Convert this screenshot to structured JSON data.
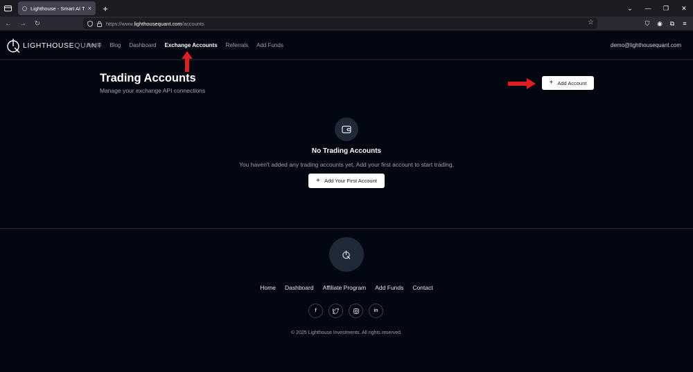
{
  "browser": {
    "tab_title": "Lighthouse - Smart AI Trading",
    "tab_close": "×",
    "new_tab": "+",
    "url_prefix": "https://www.",
    "url_host": "lighthousequant.com",
    "url_path": "/accounts",
    "back": "←",
    "forward": "→",
    "reload": "↻",
    "minimize": "—",
    "restore": "❐",
    "close": "✕"
  },
  "site": {
    "logo_bold": "LIGHTHOUSE",
    "logo_thin": "QUANT",
    "nav": [
      "Home",
      "Blog",
      "Dashboard",
      "Exchange Accounts",
      "Referrals",
      "Add Funds"
    ],
    "active_nav": "Exchange Accounts",
    "user_email": "demo@lighthousequant.com"
  },
  "main": {
    "title": "Trading Accounts",
    "subtitle": "Manage your exchange API connections",
    "add_account_label": "Add Account",
    "empty_title": "No Trading Accounts",
    "empty_text": "You haven't added any trading accounts yet. Add your first account to start trading.",
    "add_first_label": "Add Your First Account",
    "empty_icon": "wallet-icon"
  },
  "footer": {
    "links": [
      "Home",
      "Dashboard",
      "Affiliate Program",
      "Add Funds",
      "Contact"
    ],
    "socials": [
      {
        "icon": "facebook-icon",
        "glyph": "f"
      },
      {
        "icon": "twitter-icon",
        "glyph": "🐦"
      },
      {
        "icon": "instagram-icon",
        "glyph": "◎"
      },
      {
        "icon": "linkedin-icon",
        "glyph": "in"
      }
    ],
    "copyright": "© 2025 Lighthouse Investments. All rights reserved."
  },
  "colors": {
    "background": "#030712",
    "annotation_arrow": "#e11d24"
  }
}
